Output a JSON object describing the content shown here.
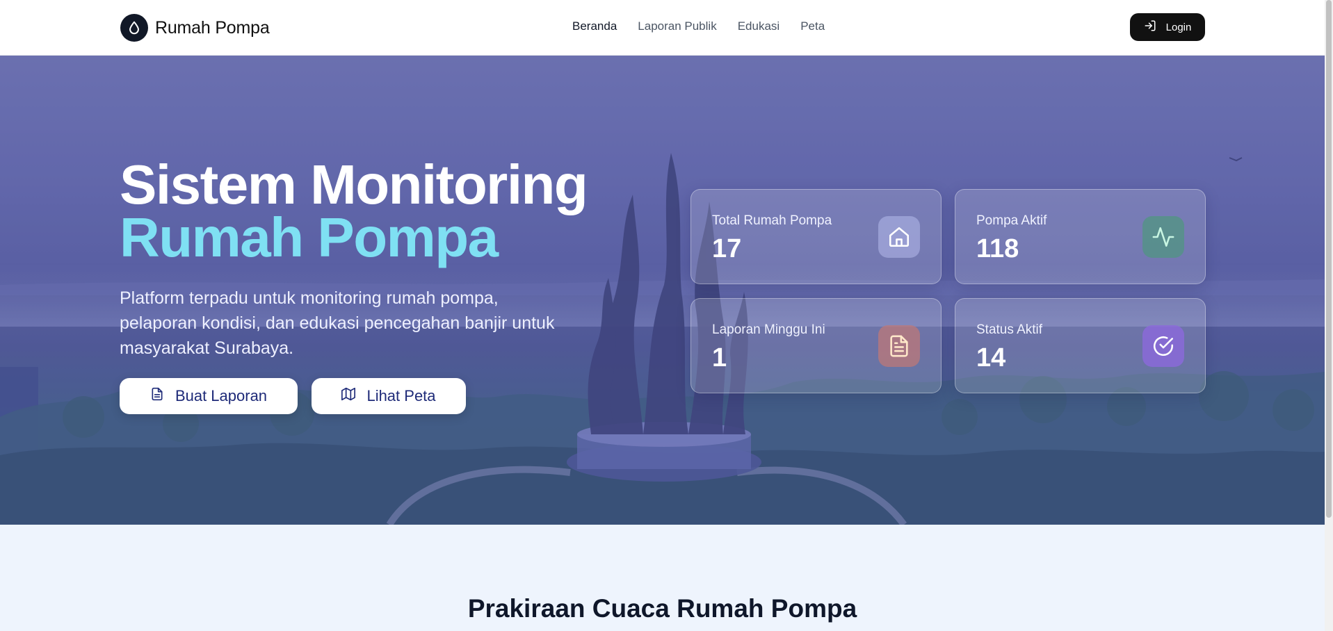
{
  "brand": {
    "name": "Rumah Pompa",
    "logo_icon": "water-drop-icon"
  },
  "nav": {
    "links": [
      {
        "label": "Beranda",
        "active": true
      },
      {
        "label": "Laporan Publik",
        "active": false
      },
      {
        "label": "Edukasi",
        "active": false
      },
      {
        "label": "Peta",
        "active": false
      }
    ],
    "login": {
      "label": "Login",
      "icon": "login-icon"
    }
  },
  "hero": {
    "title_line1": "Sistem Monitoring",
    "title_line2": "Rumah Pompa",
    "description": "Platform terpadu untuk monitoring rumah pompa, pelaporan kondisi, dan edukasi pencegahan banjir untuk masyarakat Surabaya.",
    "buttons": [
      {
        "label": "Buat Laporan",
        "icon": "document-icon"
      },
      {
        "label": "Lihat Peta",
        "icon": "map-icon"
      }
    ],
    "background": "Surabaya monument park photo with blue-violet overlay"
  },
  "stats": [
    {
      "label": "Total Rumah Pompa",
      "value": "17",
      "icon": "home-icon",
      "icon_bg": "#9ea3d8"
    },
    {
      "label": "Pompa Aktif",
      "value": "118",
      "icon": "activity-icon",
      "icon_bg": "#5b8f86"
    },
    {
      "label": "Laporan Minggu Ini",
      "value": "1",
      "icon": "file-text-icon",
      "icon_bg": "#b07c8a"
    },
    {
      "label": "Status Aktif",
      "value": "14",
      "icon": "check-circle-icon",
      "icon_bg": "#8a6fd0"
    }
  ],
  "colors": {
    "accent_title": "#7fe0f3",
    "nav_dark": "#111111",
    "section_bg": "#eef4fd"
  },
  "weather_section": {
    "title": "Prakiraan Cuaca Rumah Pompa"
  }
}
